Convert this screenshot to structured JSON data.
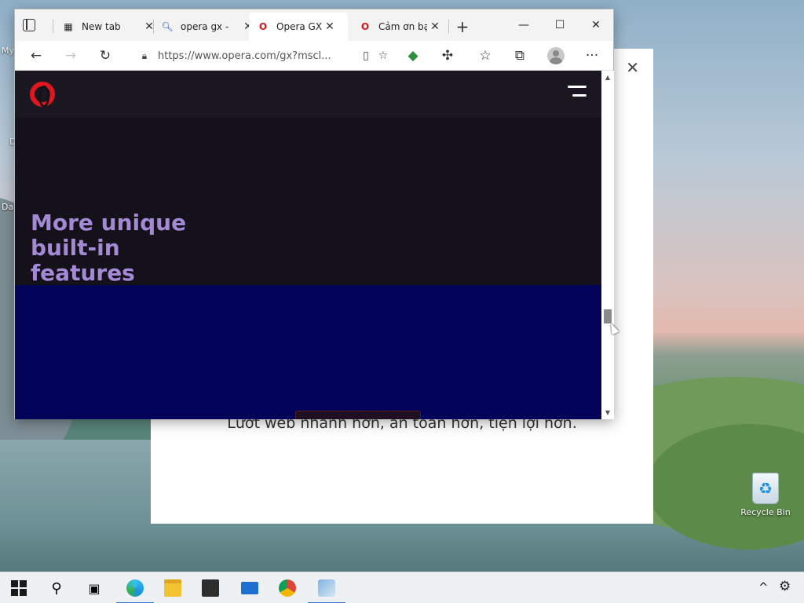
{
  "desktop": {
    "labels": [
      "My",
      "D",
      "Da"
    ],
    "recycle_bin": "Recycle Bin"
  },
  "background_window": {
    "close_glyph": "✕",
    "subtitle": "Lướt web nhanh hơn, an toàn hơn, tiện lợi hơn."
  },
  "browser": {
    "tabs": [
      {
        "title": "New tab",
        "icon": "newtab-icon",
        "active": false
      },
      {
        "title": "opera gx -",
        "icon": "search-icon",
        "active": false
      },
      {
        "title": "Opera GX |",
        "icon": "opera-gx-icon",
        "active": true
      },
      {
        "title": "Cảm ơn bạ",
        "icon": "opera-icon",
        "active": false
      }
    ],
    "new_tab_glyph": "+",
    "window_controls": {
      "minimize": "—",
      "maximize": "☐",
      "close": "✕"
    },
    "toolbar": {
      "back": "←",
      "forward": "→",
      "refresh": "↻",
      "url": "https://www.opera.com/gx?mscl...",
      "more": "···"
    },
    "page": {
      "hero_title_lines": [
        "More unique",
        "built-in",
        "features"
      ],
      "hero_title_color": "#a48ad6",
      "hero_blue": "#03035a",
      "brand_red": "#e0161e"
    },
    "scrollbar": {
      "up": "▲",
      "down": "▼",
      "position_fraction": 0.73
    }
  },
  "taskbar": {
    "apps": [
      "start",
      "search",
      "task-view",
      "edge",
      "file-explorer",
      "store",
      "mail",
      "chrome",
      "setup-app"
    ],
    "tray": {
      "chevron": "^",
      "settings": "⚙"
    }
  }
}
